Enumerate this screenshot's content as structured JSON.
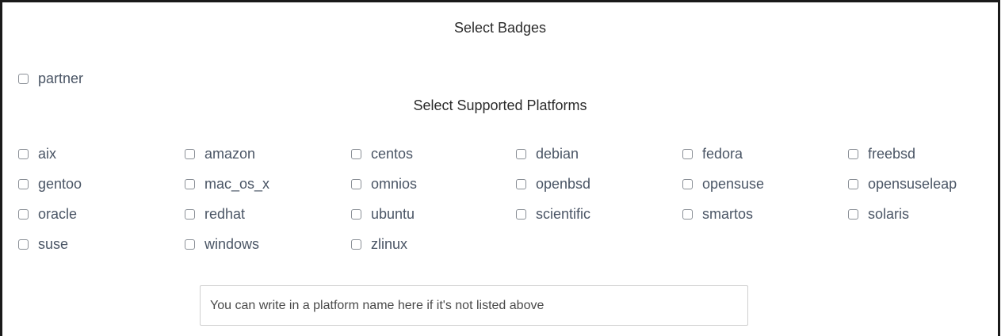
{
  "badges": {
    "heading": "Select Badges",
    "items": [
      {
        "label": "partner",
        "checked": false
      }
    ]
  },
  "platforms": {
    "heading": "Select Supported Platforms",
    "items": [
      {
        "label": "aix",
        "checked": false
      },
      {
        "label": "amazon",
        "checked": false
      },
      {
        "label": "centos",
        "checked": false
      },
      {
        "label": "debian",
        "checked": false
      },
      {
        "label": "fedora",
        "checked": false
      },
      {
        "label": "freebsd",
        "checked": false
      },
      {
        "label": "gentoo",
        "checked": false
      },
      {
        "label": "mac_os_x",
        "checked": false
      },
      {
        "label": "omnios",
        "checked": false
      },
      {
        "label": "openbsd",
        "checked": false
      },
      {
        "label": "opensuse",
        "checked": false
      },
      {
        "label": "opensuseleap",
        "checked": false
      },
      {
        "label": "oracle",
        "checked": false
      },
      {
        "label": "redhat",
        "checked": false
      },
      {
        "label": "ubuntu",
        "checked": false
      },
      {
        "label": "scientific",
        "checked": false
      },
      {
        "label": "smartos",
        "checked": false
      },
      {
        "label": "solaris",
        "checked": false
      },
      {
        "label": "suse",
        "checked": false
      },
      {
        "label": "windows",
        "checked": false
      },
      {
        "label": "zlinux",
        "checked": false
      }
    ]
  },
  "custom_platform": {
    "placeholder": "You can write in a platform name here if it's not listed above",
    "value": ""
  }
}
